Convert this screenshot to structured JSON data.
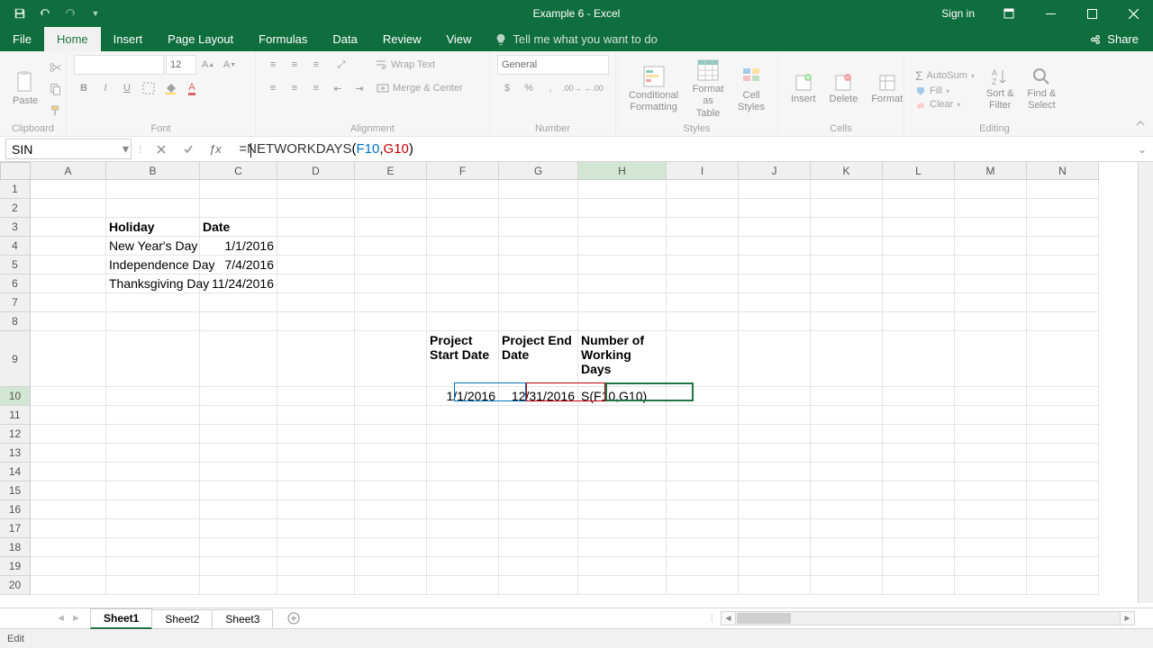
{
  "titlebar": {
    "title": "Example 6  -  Excel",
    "signin": "Sign in"
  },
  "tabs": {
    "file": "File",
    "home": "Home",
    "insert": "Insert",
    "pagelayout": "Page Layout",
    "formulas": "Formulas",
    "data": "Data",
    "review": "Review",
    "view": "View",
    "tellme": "Tell me what you want to do",
    "share": "Share"
  },
  "ribbon": {
    "clipboard": {
      "label": "Clipboard",
      "paste": "Paste"
    },
    "font": {
      "label": "Font",
      "size": "12"
    },
    "alignment": {
      "label": "Alignment",
      "wrap": "Wrap Text",
      "merge": "Merge & Center"
    },
    "number": {
      "label": "Number",
      "format": "General"
    },
    "styles": {
      "label": "Styles",
      "conditional": "Conditional\nFormatting",
      "formatas": "Format as\nTable",
      "cell": "Cell\nStyles"
    },
    "cells": {
      "label": "Cells",
      "insert": "Insert",
      "delete": "Delete",
      "format": "Format"
    },
    "editing": {
      "label": "Editing",
      "autosum": "AutoSum",
      "fill": "Fill",
      "clear": "Clear",
      "sort": "Sort &\nFilter",
      "find": "Find &\nSelect"
    }
  },
  "namebox": "SIN",
  "formula": {
    "eq": "=",
    "fn": "NETWORKDAYS",
    "open": "(",
    "ref1": "F10",
    "comma": ",",
    "ref2": "G10",
    "close": ")"
  },
  "columns": [
    "A",
    "B",
    "C",
    "D",
    "E",
    "F",
    "G",
    "H",
    "I",
    "J",
    "K",
    "L",
    "M",
    "N"
  ],
  "cells": {
    "B3": "Holiday",
    "C3": "Date",
    "B4": "New Year's Day",
    "C4": "1/1/2016",
    "B5": "Independence Day",
    "C5": "7/4/2016",
    "B6": "Thanksgiving Day",
    "C6": "11/24/2016",
    "F9": "Project Start Date",
    "G9": "Project End Date",
    "H9": "Number of Working Days",
    "F10": "1/1/2016",
    "G10": "12/31/2016",
    "H10": "S(F10,G10)"
  },
  "sheets": [
    "Sheet1",
    "Sheet2",
    "Sheet3"
  ],
  "status": "Edit",
  "colors": {
    "green": "#217346",
    "selblue": "#0070c0",
    "selred": "#c00000"
  }
}
